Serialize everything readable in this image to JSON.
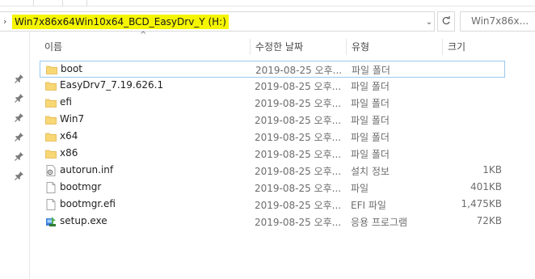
{
  "address": {
    "path": "Win7x86x64Win10x64_BCD_EasyDrv_Y (H:)",
    "search_placeholder": "Win7x86x..."
  },
  "columns": {
    "name": "이름",
    "date": "수정한 날짜",
    "type": "유형",
    "size": "크기"
  },
  "files": [
    {
      "name": "boot",
      "date": "2019-08-25 오후...",
      "type": "파일 폴더",
      "size": "",
      "icon": "folder-icon"
    },
    {
      "name": "EasyDrv7_7.19.626.1",
      "date": "2019-08-25 오후...",
      "type": "파일 폴더",
      "size": "",
      "icon": "folder-icon"
    },
    {
      "name": "efi",
      "date": "2019-08-25 오후...",
      "type": "파일 폴더",
      "size": "",
      "icon": "folder-icon"
    },
    {
      "name": "Win7",
      "date": "2019-08-25 오후...",
      "type": "파일 폴더",
      "size": "",
      "icon": "folder-icon"
    },
    {
      "name": "x64",
      "date": "2019-08-25 오후...",
      "type": "파일 폴더",
      "size": "",
      "icon": "folder-icon"
    },
    {
      "name": "x86",
      "date": "2019-08-25 오후...",
      "type": "파일 폴더",
      "size": "",
      "icon": "folder-icon"
    },
    {
      "name": "autorun.inf",
      "date": "2019-08-25 오후...",
      "type": "설치 정보",
      "size": "1KB",
      "icon": "settings-file-icon"
    },
    {
      "name": "bootmgr",
      "date": "2019-08-25 오후...",
      "type": "파일",
      "size": "401KB",
      "icon": "file-icon"
    },
    {
      "name": "bootmgr.efi",
      "date": "2019-08-25 오후...",
      "type": "EFI 파일",
      "size": "1,475KB",
      "icon": "file-icon"
    },
    {
      "name": "setup.exe",
      "date": "2019-08-25 오후...",
      "type": "응용 프로그램",
      "size": "72KB",
      "icon": "installer-icon"
    }
  ],
  "colors": {
    "highlight": "#f5f500",
    "folder": "#f8d775",
    "selection_border": "#99c9ef"
  }
}
